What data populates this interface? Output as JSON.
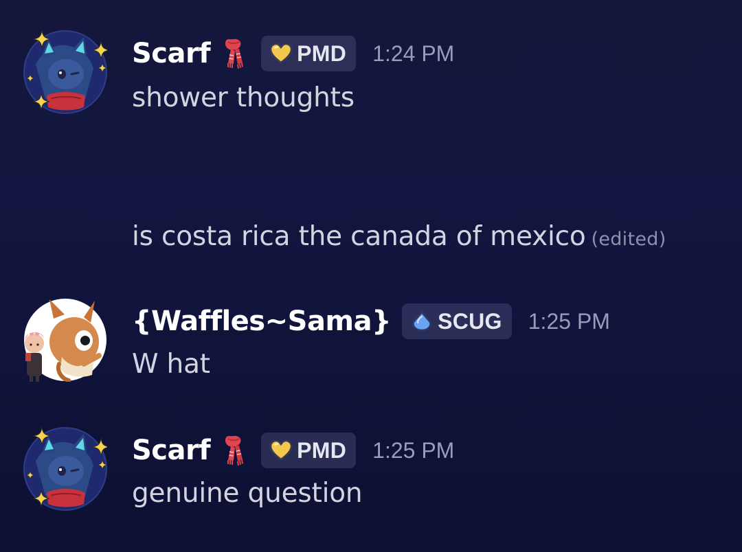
{
  "messages": [
    {
      "author": "Scarf",
      "author_emoji": "scarf-emoji",
      "tag": {
        "icon": "gold-heart-icon",
        "label": "PMD"
      },
      "timestamp": "1:24 PM",
      "lines": [
        "shower thoughts",
        "",
        "",
        "is costa rica the canada of mexico"
      ],
      "edited_label": "(edited)"
    },
    {
      "author": "{Waffles~Sama}",
      "tag": {
        "icon": "blue-gem-icon",
        "label": "SCUG"
      },
      "timestamp": "1:25 PM",
      "lines": [
        "W hat"
      ]
    },
    {
      "author": "Scarf",
      "author_emoji": "scarf-emoji",
      "tag": {
        "icon": "gold-heart-icon",
        "label": "PMD"
      },
      "timestamp": "1:25 PM",
      "lines": [
        "genuine question"
      ]
    }
  ],
  "colors": {
    "background": "#121640",
    "username": "#ffffff",
    "message_text": "#d3d4e2",
    "timestamp": "#9a9cb8",
    "tag_background": "#2e3258",
    "pmd_heart": "#f2c94c",
    "scug_gem": "#6aa4f0"
  }
}
